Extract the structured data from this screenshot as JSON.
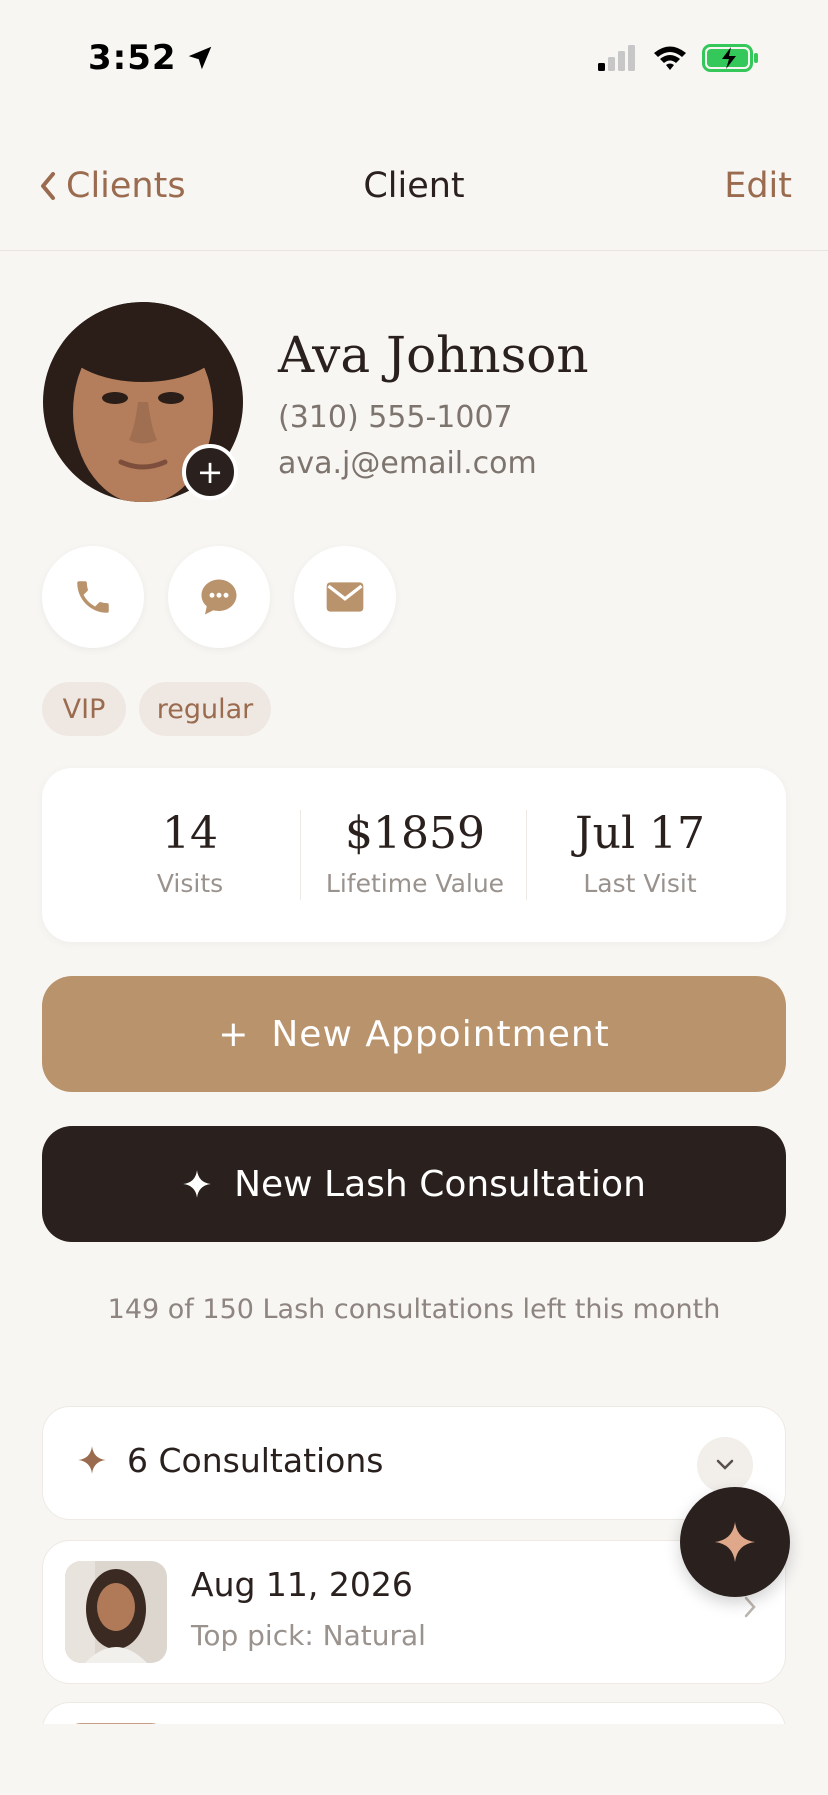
{
  "status_bar": {
    "time": "3:52",
    "icons": [
      "location-arrow-icon",
      "cellular-signal-icon",
      "wifi-icon",
      "battery-charging-icon"
    ],
    "battery_color": "#34C759"
  },
  "nav": {
    "back_label": "Clients",
    "title": "Client",
    "edit_label": "Edit",
    "accent_color": "#9A6B4E"
  },
  "client": {
    "name": "Ava Johnson",
    "phone": "(310) 555-1007",
    "email": "ava.j@email.com",
    "avatar_add_symbol": "+"
  },
  "contact_actions": [
    {
      "name": "call",
      "icon": "phone-icon"
    },
    {
      "name": "message",
      "icon": "chat-bubble-icon"
    },
    {
      "name": "email",
      "icon": "envelope-icon"
    }
  ],
  "tags": [
    "VIP",
    "regular"
  ],
  "stats": [
    {
      "value": "14",
      "label": "Visits"
    },
    {
      "value": "$1859",
      "label": "Lifetime Value"
    },
    {
      "value": "Jul 17",
      "label": "Last Visit"
    }
  ],
  "actions": {
    "new_appointment_icon": "+",
    "new_appointment_label": "New Appointment",
    "new_consultation_label": "New Lash Consultation",
    "primary_color": "#B9936C",
    "dark_color": "#2A211E"
  },
  "quota_text": "149 of 150 Lash consultations left this month",
  "consultations": {
    "header": "6 Consultations",
    "items": [
      {
        "date": "Aug 11, 2026",
        "top_pick": "Top pick: Natural"
      }
    ]
  },
  "fab": {
    "icon": "sparkle-icon"
  }
}
